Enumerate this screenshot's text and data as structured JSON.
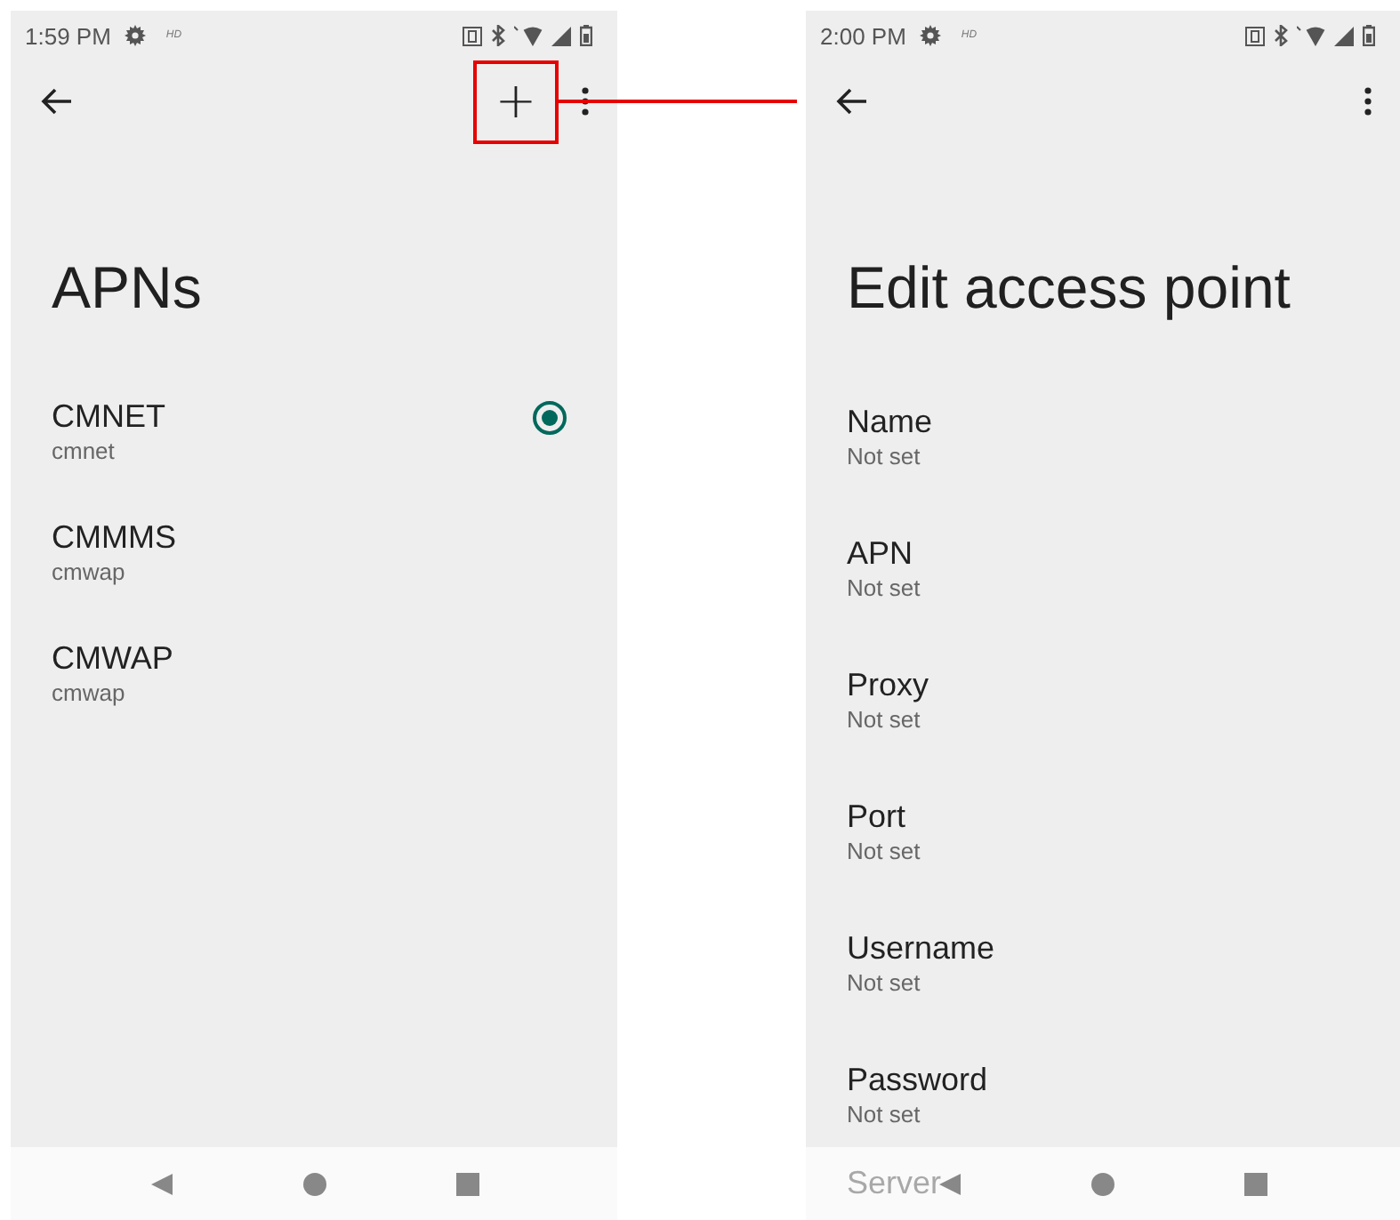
{
  "screens": [
    {
      "kind": "apn_list",
      "time": "1:59 PM",
      "hd": "HD",
      "add_button": {
        "label": "+",
        "highlighted": true
      },
      "title": "APNs",
      "items": [
        {
          "title": "CMNET",
          "subtitle": "cmnet",
          "selected": true
        },
        {
          "title": "CMMMS",
          "subtitle": "cmwap",
          "selected": false
        },
        {
          "title": "CMWAP",
          "subtitle": "cmwap",
          "selected": false
        }
      ]
    },
    {
      "kind": "edit",
      "time": "2:00 PM",
      "hd": "HD",
      "title": "Edit access point",
      "items": [
        {
          "title": "Name",
          "subtitle": "Not set"
        },
        {
          "title": "APN",
          "subtitle": "Not set"
        },
        {
          "title": "Proxy",
          "subtitle": "Not set"
        },
        {
          "title": "Port",
          "subtitle": "Not set"
        },
        {
          "title": "Username",
          "subtitle": "Not set"
        },
        {
          "title": "Password",
          "subtitle": "Not set"
        }
      ],
      "obscured_item": "Server"
    }
  ]
}
